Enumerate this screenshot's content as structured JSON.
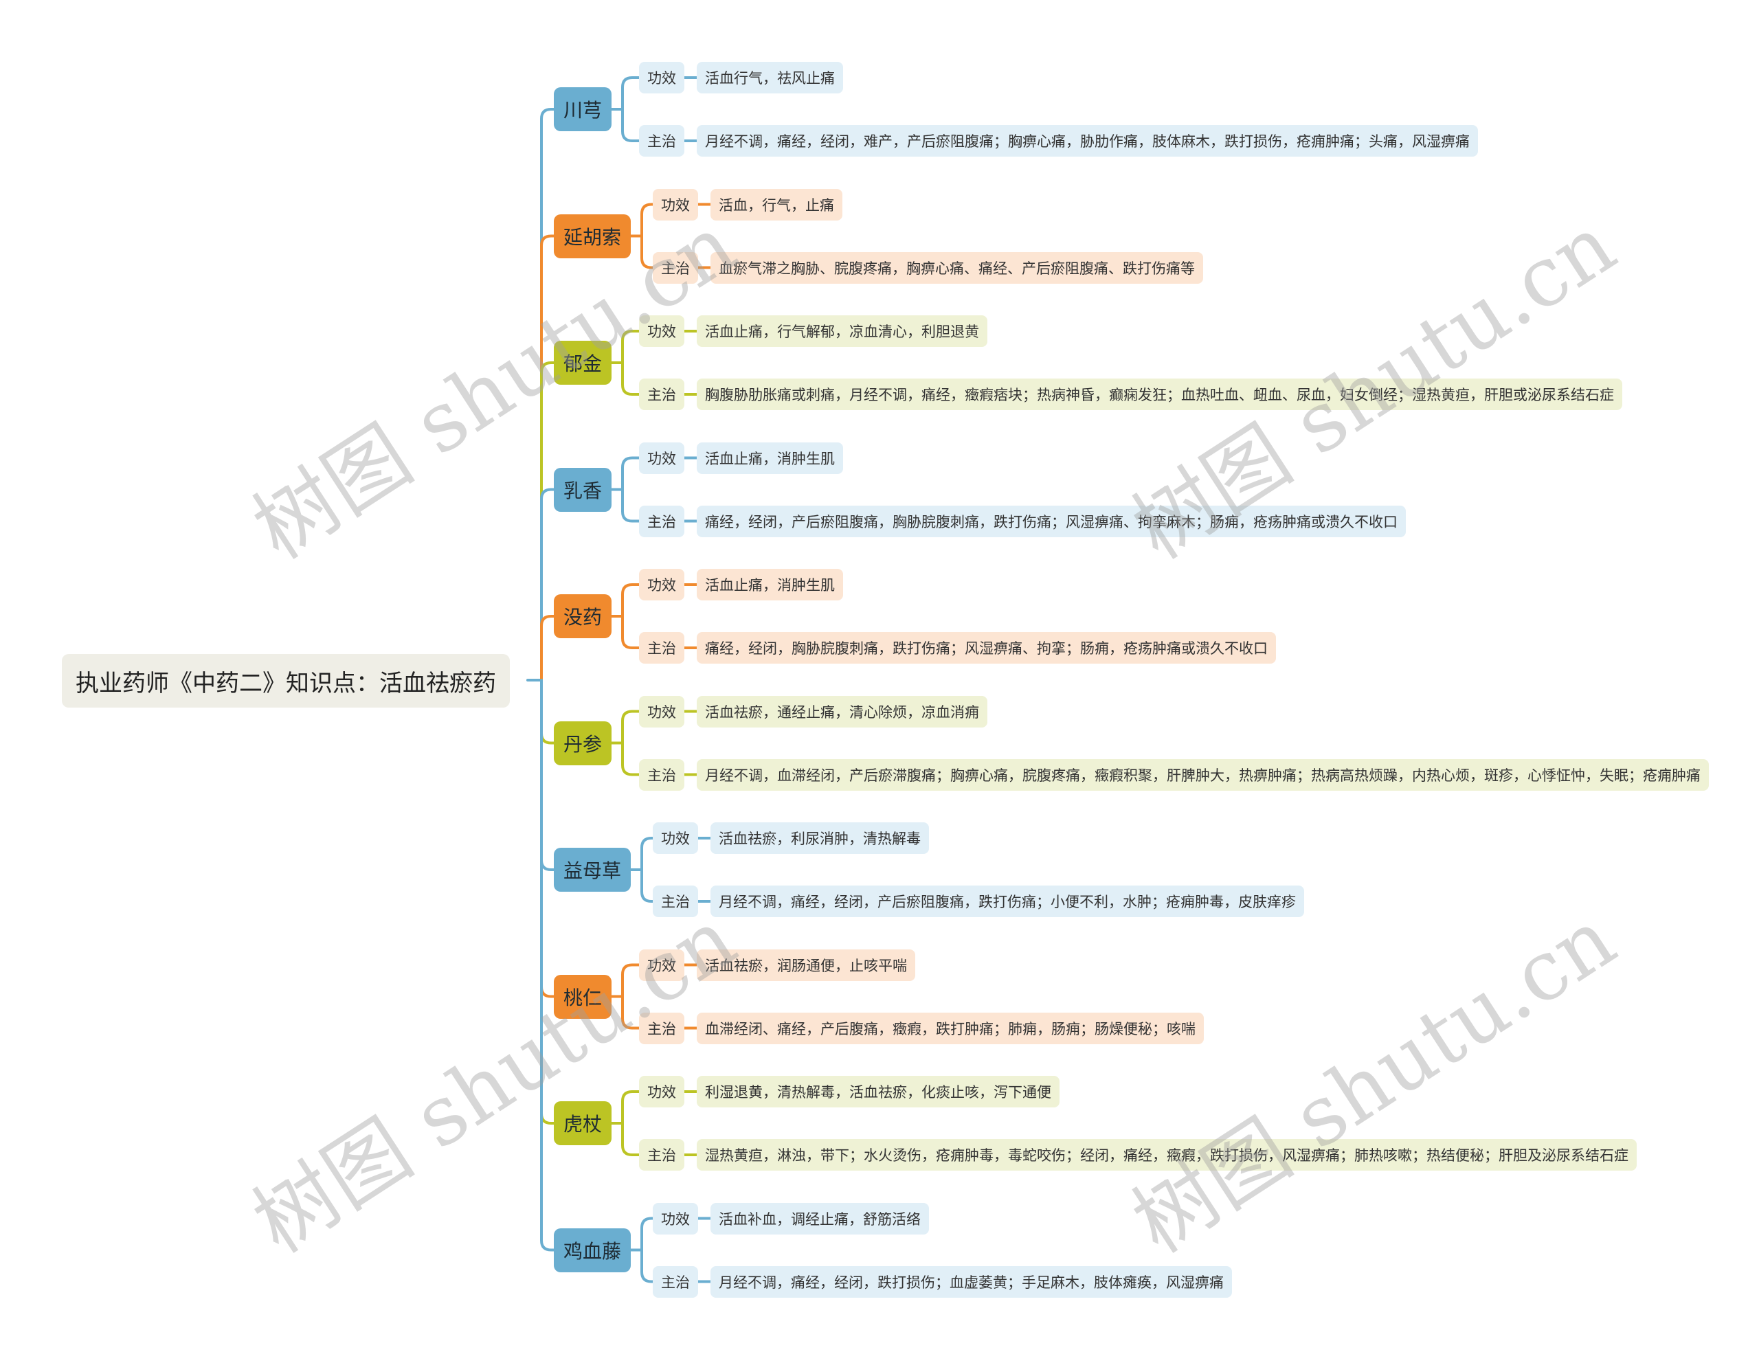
{
  "root": {
    "title": "执业药师《中药二》知识点：活血祛瘀药"
  },
  "themes": {
    "blue": {
      "cat": "#6aaed0",
      "line": "#6aaed0",
      "leaf": "#e1eff7"
    },
    "orange": {
      "cat": "#f08a2e",
      "line": "#f08a2e",
      "leaf": "#fce5d3"
    },
    "olive": {
      "cat": "#bcc424",
      "line": "#bcc424",
      "leaf": "#eff2d5"
    }
  },
  "branches": [
    {
      "name": "川芎",
      "theme": "blue",
      "effect_label": "功效",
      "effect": "活血行气，祛风止痛",
      "indication_label": "主治",
      "indication": "月经不调，痛经，经闭，难产，产后瘀阻腹痛；胸痹心痛，胁肋作痛，肢体麻木，跌打损伤，疮痈肿痛；头痛，风湿痹痛"
    },
    {
      "name": "延胡索",
      "theme": "orange",
      "effect_label": "功效",
      "effect": "活血，行气，止痛",
      "indication_label": "主治",
      "indication": "血瘀气滞之胸胁、脘腹疼痛，胸痹心痛、痛经、产后瘀阻腹痛、跌打伤痛等"
    },
    {
      "name": "郁金",
      "theme": "olive",
      "effect_label": "功效",
      "effect": "活血止痛，行气解郁，凉血清心，利胆退黄",
      "indication_label": "主治",
      "indication": "胸腹胁肋胀痛或刺痛，月经不调，痛经，癥瘕痞块；热病神昏，癫痫发狂；血热吐血、衄血、尿血，妇女倒经；湿热黄疸，肝胆或泌尿系结石症"
    },
    {
      "name": "乳香",
      "theme": "blue",
      "effect_label": "功效",
      "effect": "活血止痛，消肿生肌",
      "indication_label": "主治",
      "indication": "痛经，经闭，产后瘀阻腹痛，胸胁脘腹刺痛，跌打伤痛；风湿痹痛、拘挛麻木；肠痈，疮疡肿痛或溃久不收口"
    },
    {
      "name": "没药",
      "theme": "orange",
      "effect_label": "功效",
      "effect": "活血止痛，消肿生肌",
      "indication_label": "主治",
      "indication": "痛经，经闭，胸胁脘腹刺痛，跌打伤痛；风湿痹痛、拘挛；肠痈，疮疡肿痛或溃久不收口"
    },
    {
      "name": "丹参",
      "theme": "olive",
      "effect_label": "功效",
      "effect": "活血祛瘀，通经止痛，清心除烦，凉血消痈",
      "indication_label": "主治",
      "indication": "月经不调，血滞经闭，产后瘀滞腹痛；胸痹心痛，脘腹疼痛，癥瘕积聚，肝脾肿大，热痹肿痛；热病高热烦躁，内热心烦，斑疹，心悸怔忡，失眠；疮痈肿痛"
    },
    {
      "name": "益母草",
      "theme": "blue",
      "effect_label": "功效",
      "effect": "活血祛瘀，利尿消肿，清热解毒",
      "indication_label": "主治",
      "indication": "月经不调，痛经，经闭，产后瘀阻腹痛，跌打伤痛；小便不利，水肿；疮痈肿毒，皮肤痒疹"
    },
    {
      "name": "桃仁",
      "theme": "orange",
      "effect_label": "功效",
      "effect": "活血祛瘀，润肠通便，止咳平喘",
      "indication_label": "主治",
      "indication": "血滞经闭、痛经，产后腹痛，癥瘕，跌打肿痛；肺痈，肠痈；肠燥便秘；咳喘"
    },
    {
      "name": "虎杖",
      "theme": "olive",
      "effect_label": "功效",
      "effect": "利湿退黄，清热解毒，活血祛瘀，化痰止咳，泻下通便",
      "indication_label": "主治",
      "indication": "湿热黄疸，淋浊，带下；水火烫伤，疮痈肿毒，毒蛇咬伤；经闭，痛经，癥瘕，跌打损伤，风湿痹痛；肺热咳嗽；热结便秘；肝胆及泌尿系结石症"
    },
    {
      "name": "鸡血藤",
      "theme": "blue",
      "effect_label": "功效",
      "effect": "活血补血，调经止痛，舒筋活络",
      "indication_label": "主治",
      "indication": "月经不调，痛经，经闭，跌打损伤；血虚萎黄；手足麻木，肢体瘫痪，风湿痹痛"
    }
  ],
  "watermark": {
    "text": "树图 shutu.cn"
  }
}
